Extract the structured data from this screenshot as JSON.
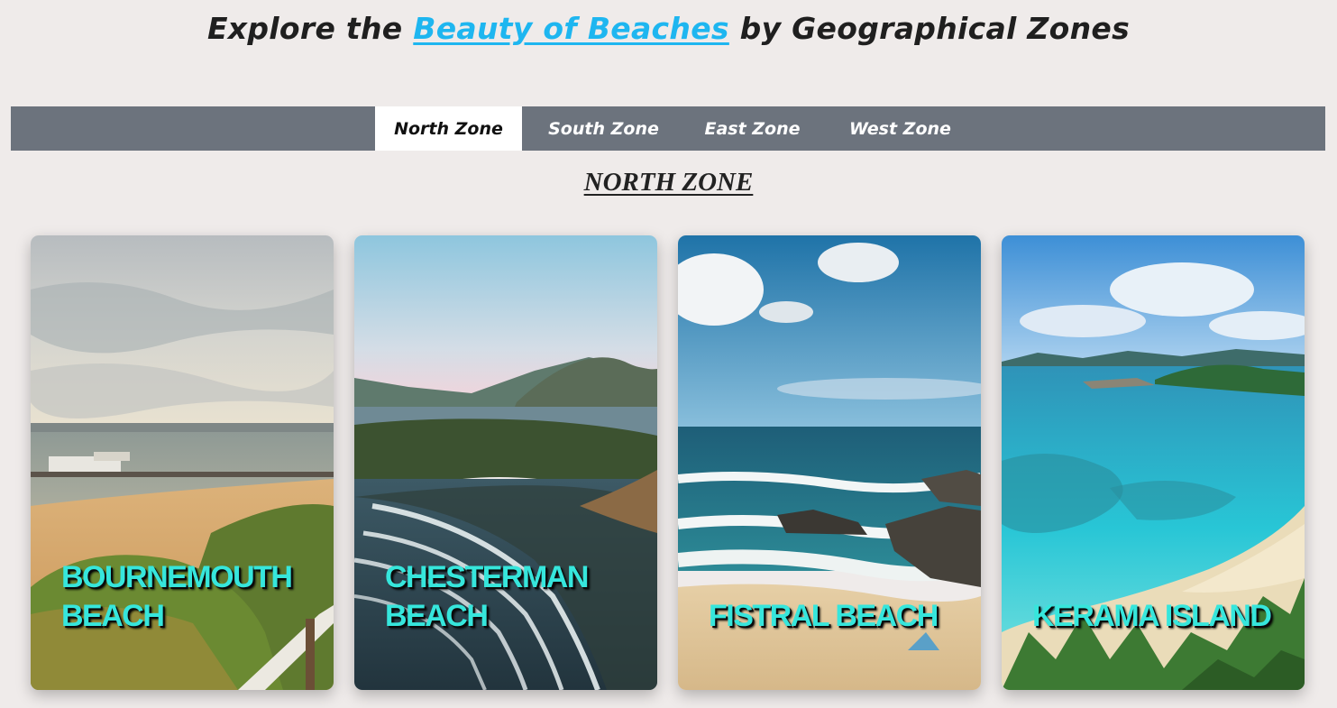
{
  "heading": {
    "prefix": "Explore the",
    "link": "Beauty of Beaches",
    "suffix": "by Geographical Zones"
  },
  "nav": {
    "tabs": [
      {
        "label": "North Zone",
        "active": true
      },
      {
        "label": "South Zone",
        "active": false
      },
      {
        "label": "East Zone",
        "active": false
      },
      {
        "label": "West Zone",
        "active": false
      }
    ]
  },
  "section": {
    "title": "NORTH ZONE"
  },
  "cards": [
    {
      "title": "Bournemouth Beach"
    },
    {
      "title": "Chesterman Beach"
    },
    {
      "title": "Fistral Beach"
    },
    {
      "title": "Kerama Island"
    }
  ],
  "colors": {
    "background": "#efebea",
    "nav_bar": "#6c737d",
    "link": "#1eb6f0",
    "card_label": "#36e6dc"
  }
}
